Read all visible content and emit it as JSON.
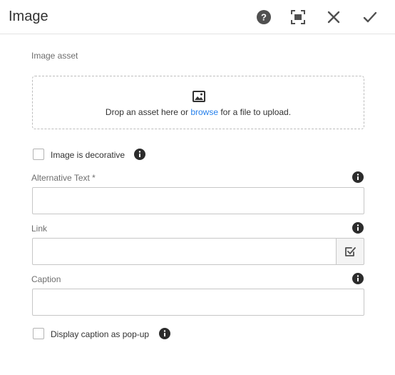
{
  "dialog": {
    "title": "Image"
  },
  "toolbar": {
    "help_icon": "help-icon",
    "fullscreen_icon": "fullscreen-icon",
    "close_icon": "close-icon",
    "done_icon": "checkmark-icon"
  },
  "image_asset": {
    "label": "Image asset",
    "drop_text_before": "Drop an asset here or ",
    "drop_link": "browse",
    "drop_text_after": " for a file to upload."
  },
  "decorative": {
    "label": "Image is decorative",
    "checked": false
  },
  "alt_text": {
    "label": "Alternative Text *",
    "value": ""
  },
  "link": {
    "label": "Link",
    "value": ""
  },
  "caption": {
    "label": "Caption",
    "value": ""
  },
  "caption_popup": {
    "label": "Display caption as pop-up",
    "checked": false
  },
  "colors": {
    "accent": "#2680eb",
    "icon": "#4b4b4b",
    "border": "#c7c7c7"
  }
}
